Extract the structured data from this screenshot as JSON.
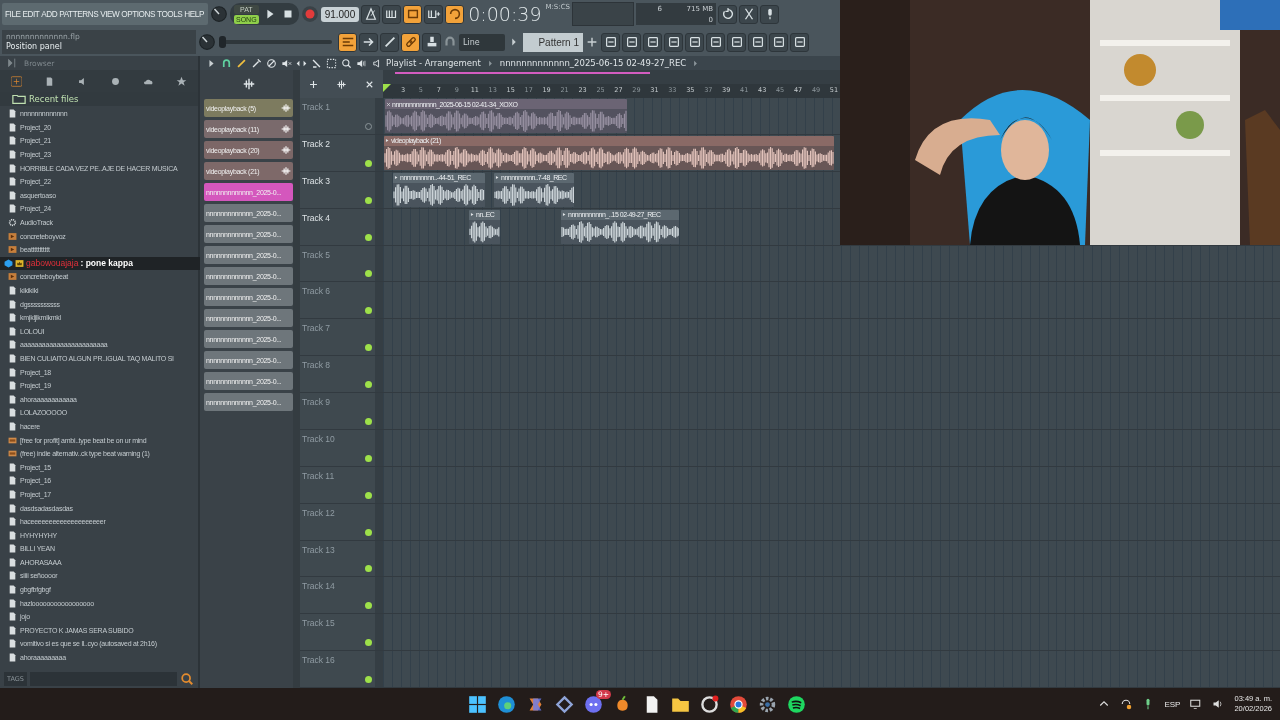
{
  "menu": [
    "FILE",
    "EDIT",
    "ADD",
    "PATTERNS",
    "VIEW",
    "OPTIONS",
    "TOOLS",
    "HELP"
  ],
  "transport": {
    "modes": [
      {
        "label": "PAT",
        "selected": false
      },
      {
        "label": "SONG",
        "selected": true
      }
    ],
    "tempo": "91.000",
    "time": "0:00:39",
    "time_unit": "M:S:CS",
    "cpu": "6",
    "memory": "715 MB",
    "polyphony": "0"
  },
  "hint": {
    "file": "nnnnnnnnnnnnn.flp",
    "text": "Position panel"
  },
  "master_pitch": {
    "level": 0
  },
  "snap": "Line",
  "pattern": "Pattern 1",
  "browser": {
    "title": "Browser",
    "section": "Recent files",
    "tags_label": "TAGS",
    "items": [
      {
        "name": "nnnnnnnnnnnnn",
        "kind": "file"
      },
      {
        "name": "Project_20",
        "kind": "file"
      },
      {
        "name": "Project_21",
        "kind": "file"
      },
      {
        "name": "Project_23",
        "kind": "file"
      },
      {
        "name": "HORRIBLE CADA VEZ PE..AJE DE HACER MUSICA",
        "kind": "file"
      },
      {
        "name": "Project_22",
        "kind": "file"
      },
      {
        "name": "asquertoaso",
        "kind": "file"
      },
      {
        "name": "Project_24",
        "kind": "file"
      },
      {
        "name": "AudioTrack",
        "kind": "track"
      },
      {
        "name": "concreteboyvoz",
        "kind": "audio"
      },
      {
        "name": "beattttttttttt",
        "kind": "audio"
      },
      {
        "name": "concreteboybeat",
        "kind": "audio"
      },
      {
        "name": "kikikiki",
        "kind": "file"
      },
      {
        "name": "dgssssssssss",
        "kind": "file"
      },
      {
        "name": "kmjkljlkmlkmkl",
        "kind": "file"
      },
      {
        "name": "LOLOUI",
        "kind": "file"
      },
      {
        "name": "aaaaaaaaaaaaaaaaaaaaaaaa",
        "kind": "file"
      },
      {
        "name": "BIEN CULIAITO ALGUN PR..IGUAL TAQ MALITO SI",
        "kind": "file"
      },
      {
        "name": "Project_18",
        "kind": "file"
      },
      {
        "name": "Project_19",
        "kind": "file"
      },
      {
        "name": "ahoraaaaaaaaaaaa",
        "kind": "file"
      },
      {
        "name": "LOLAZOOOOO",
        "kind": "file"
      },
      {
        "name": "hacere",
        "kind": "file"
      },
      {
        "name": "[free for profit] ambi..type beat be on ur mind",
        "kind": "mp3"
      },
      {
        "name": "(free) indie  alternativ..ck type beat warning (1)",
        "kind": "mp3"
      },
      {
        "name": "Project_15",
        "kind": "file"
      },
      {
        "name": "Project_16",
        "kind": "file"
      },
      {
        "name": "Project_17",
        "kind": "file"
      },
      {
        "name": "dasdsadasdasdas",
        "kind": "file"
      },
      {
        "name": "haceeeeeeeeeeeeeeeeeeeer",
        "kind": "file"
      },
      {
        "name": "HYHYHYHY",
        "kind": "file"
      },
      {
        "name": "BILLI YEAN",
        "kind": "file"
      },
      {
        "name": "AHORASAAA",
        "kind": "file"
      },
      {
        "name": "siiii señoooor",
        "kind": "file"
      },
      {
        "name": "gbgfbfgbgf",
        "kind": "file"
      },
      {
        "name": "hazlooooooooooooooooo",
        "kind": "file"
      },
      {
        "name": "jojo",
        "kind": "file"
      },
      {
        "name": "PROYECTO K JAMAS SERA SUBIDO",
        "kind": "file"
      },
      {
        "name": "vomitivo si es que se ll..cyo (autosaved at 2h16)",
        "kind": "file"
      },
      {
        "name": "ahoraaaaaaaaa",
        "kind": "file"
      }
    ]
  },
  "chat": {
    "user": "gabowouajaja",
    "message": ": pone kappa"
  },
  "channels": [
    {
      "name": "videoplayback (5)",
      "kind": "sample",
      "color": "#7d7b5f"
    },
    {
      "name": "videoplayback (11)",
      "kind": "sample",
      "color": "#7a6a6c"
    },
    {
      "name": "videoplayback (20)",
      "kind": "sample",
      "color": "#7c6767"
    },
    {
      "name": "videoplayback (21)",
      "kind": "sample",
      "color": "#7e6969"
    },
    {
      "name": "nnnnnnnnnnnnn_2025-0...",
      "kind": "recording",
      "color": "#d457bd"
    },
    {
      "name": "nnnnnnnnnnnnn_2025-0...",
      "kind": "recording",
      "color": "#6e767b"
    },
    {
      "name": "nnnnnnnnnnnnn_2025-0...",
      "kind": "recording",
      "color": "#6e767b"
    },
    {
      "name": "nnnnnnnnnnnnn_2025-0...",
      "kind": "recording",
      "color": "#6e767b"
    },
    {
      "name": "nnnnnnnnnnnnn_2025-0...",
      "kind": "recording",
      "color": "#6e767b"
    },
    {
      "name": "nnnnnnnnnnnnn_2025-0...",
      "kind": "recording",
      "color": "#6e767b"
    },
    {
      "name": "nnnnnnnnnnnnn_2025-0...",
      "kind": "recording",
      "color": "#6e767b"
    },
    {
      "name": "nnnnnnnnnnnnn_2025-0...",
      "kind": "recording",
      "color": "#6e767b"
    },
    {
      "name": "nnnnnnnnnnnnn_2025-0...",
      "kind": "recording",
      "color": "#6e767b"
    },
    {
      "name": "nnnnnnnnnnnnn_2025-0...",
      "kind": "recording",
      "color": "#6e767b"
    },
    {
      "name": "nnnnnnnnnnnnn_2025-0...",
      "kind": "recording",
      "color": "#6e767b"
    }
  ],
  "playlist": {
    "title": "Playlist - Arrangement",
    "clip_name": "nnnnnnnnnnnnn_2025-06-15 02-49-27_REC",
    "ruler": [
      "3",
      "5",
      "7",
      "9",
      "11",
      "13",
      "15",
      "17",
      "19",
      "21",
      "23",
      "25",
      "27",
      "29",
      "31",
      "33",
      "35",
      "37",
      "39",
      "41",
      "43",
      "45",
      "47",
      "49",
      "51"
    ],
    "tracks": [
      {
        "name": "Track 1",
        "muted": true,
        "clips": [
          {
            "name": "nnnnnnnnnnnnn_2025-06-15 02-41-34_XOXO",
            "color": "#6b6474"
          }
        ]
      },
      {
        "name": "Track 2",
        "muted": false,
        "clips": [
          {
            "name": "videoplayback (21)",
            "color": "#8a6a66"
          }
        ]
      },
      {
        "name": "Track 3",
        "muted": false,
        "clips": [
          {
            "name": "nnnnnnnnnn..-44-51_REC",
            "color": "#5c6870"
          },
          {
            "name": "nnnnnnnnnn..7-48_REC",
            "color": "#5c6870"
          }
        ]
      },
      {
        "name": "Track 4",
        "muted": false,
        "clips": [
          {
            "name": "nn..EC",
            "color": "#5c6870"
          },
          {
            "name": "nnnnnnnnnnn_..15 02-49-27_REC",
            "color": "#5c6870"
          }
        ]
      },
      {
        "name": "Track 5",
        "muted": false
      },
      {
        "name": "Track 6",
        "muted": false
      },
      {
        "name": "Track 7",
        "muted": false
      },
      {
        "name": "Track 8",
        "muted": false
      },
      {
        "name": "Track 9",
        "muted": false
      },
      {
        "name": "Track 10",
        "muted": false
      },
      {
        "name": "Track 11",
        "muted": false
      },
      {
        "name": "Track 12",
        "muted": false
      },
      {
        "name": "Track 13",
        "muted": false
      },
      {
        "name": "Track 14",
        "muted": false
      },
      {
        "name": "Track 15",
        "muted": false
      },
      {
        "name": "Track 16",
        "muted": false
      }
    ]
  },
  "taskbar": {
    "badge": "9+",
    "language": "ESP",
    "time": "03:49 a. m.",
    "date": "20/02/2026"
  }
}
